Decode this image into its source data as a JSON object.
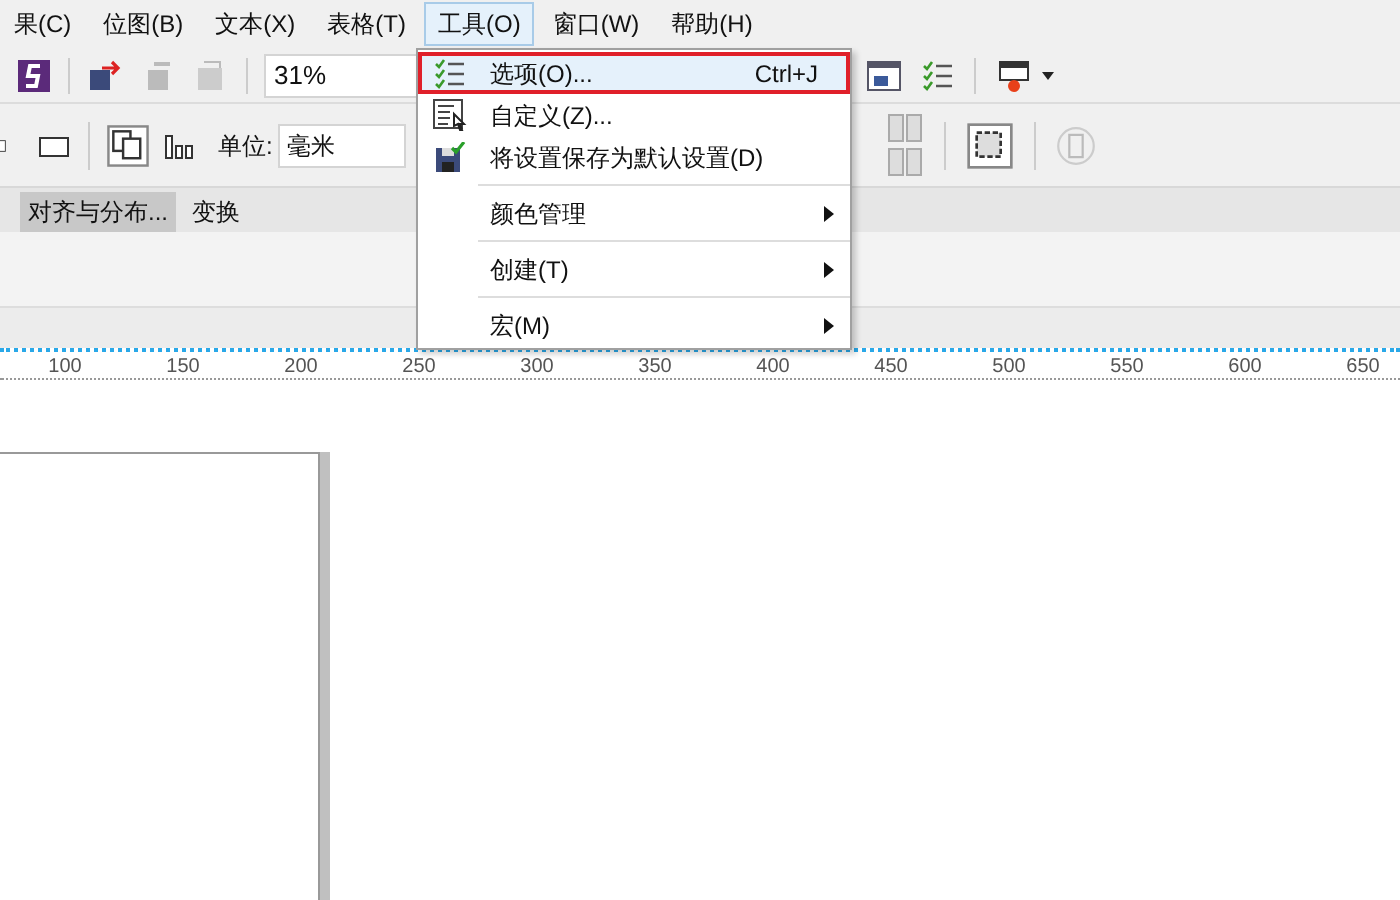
{
  "menu_bar": [
    {
      "label": "果(C)",
      "selected": false
    },
    {
      "label": "位图(B)",
      "selected": false
    },
    {
      "label": "文本(X)",
      "selected": false
    },
    {
      "label": "表格(T)",
      "selected": false
    },
    {
      "label": "工具(O)",
      "selected": true
    },
    {
      "label": "窗口(W)",
      "selected": false
    },
    {
      "label": "帮助(H)",
      "selected": false
    }
  ],
  "toolbar": {
    "zoom": "31%"
  },
  "property_bar": {
    "unit_label": "单位:",
    "unit_value": "毫米"
  },
  "docker_tabs": [
    {
      "label": "对齐与分布...",
      "selected": true
    },
    {
      "label": "变换",
      "selected": false
    }
  ],
  "dropdown": [
    {
      "kind": "command",
      "label": "选项(O)...",
      "shortcut": "Ctrl+J",
      "selected": true
    },
    {
      "kind": "command",
      "label": "自定义(Z)...",
      "selected": false
    },
    {
      "kind": "command",
      "label": "将设置保存为默认设置(D)",
      "selected": false
    },
    {
      "kind": "separator"
    },
    {
      "kind": "submenu",
      "label": "颜色管理",
      "selected": false
    },
    {
      "kind": "separator"
    },
    {
      "kind": "submenu",
      "label": "创建(T)",
      "selected": false
    },
    {
      "kind": "separator"
    },
    {
      "kind": "submenu",
      "label": "宏(M)",
      "selected": false
    }
  ],
  "ruler": [
    "100",
    "150",
    "200",
    "250",
    "300",
    "350",
    "400",
    "450",
    "500",
    "550",
    "600",
    "650"
  ]
}
